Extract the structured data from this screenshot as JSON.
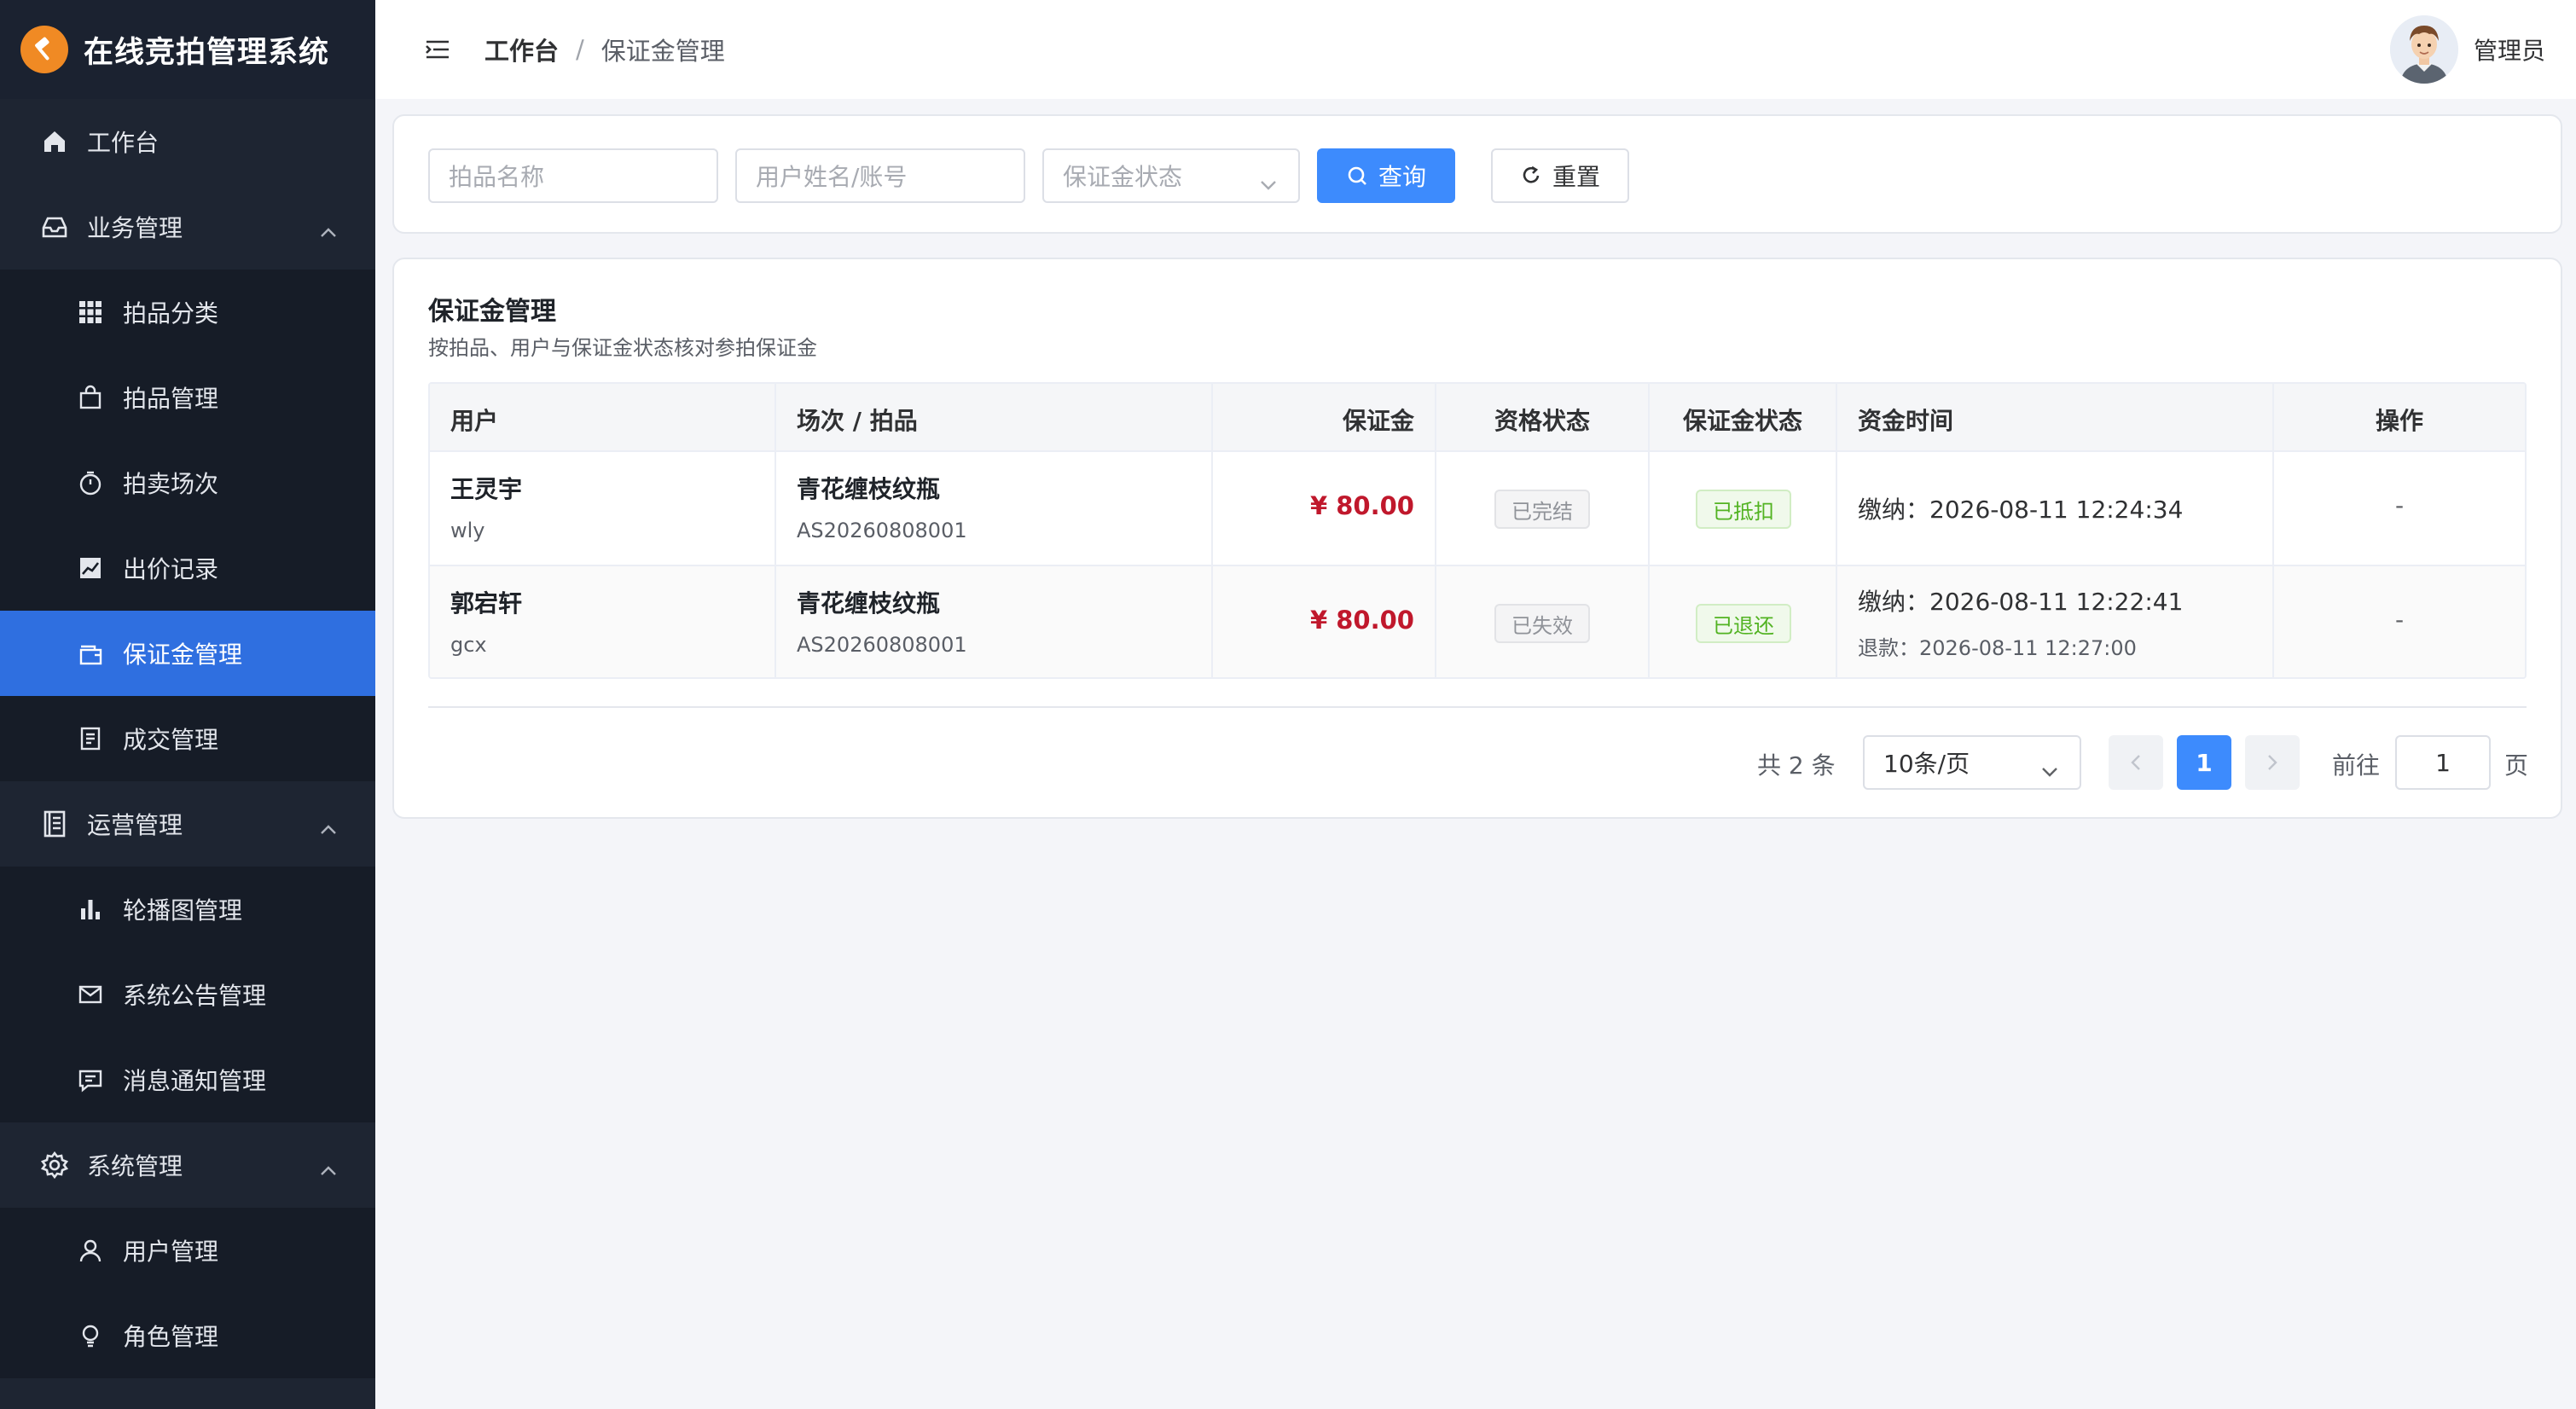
{
  "app": {
    "title": "在线竞拍管理系统"
  },
  "sidebar": {
    "items": [
      {
        "label": "工作台",
        "icon": "home-icon"
      },
      {
        "label": "业务管理",
        "icon": "inbox-icon",
        "expanded": true,
        "children": [
          {
            "label": "拍品分类",
            "icon": "grid-icon"
          },
          {
            "label": "拍品管理",
            "icon": "shopping-bag-icon"
          },
          {
            "label": "拍卖场次",
            "icon": "timer-icon"
          },
          {
            "label": "出价记录",
            "icon": "trend-chart-icon"
          },
          {
            "label": "保证金管理",
            "icon": "wallet-icon",
            "active": true
          },
          {
            "label": "成交管理",
            "icon": "document-icon"
          }
        ]
      },
      {
        "label": "运营管理",
        "icon": "notebook-icon",
        "expanded": true,
        "children": [
          {
            "label": "轮播图管理",
            "icon": "bar-chart-icon"
          },
          {
            "label": "系统公告管理",
            "icon": "message-icon"
          },
          {
            "label": "消息通知管理",
            "icon": "chat-icon"
          }
        ]
      },
      {
        "label": "系统管理",
        "icon": "gear-icon",
        "expanded": true,
        "children": [
          {
            "label": "用户管理",
            "icon": "user-icon"
          },
          {
            "label": "角色管理",
            "icon": "bulb-icon"
          }
        ]
      }
    ]
  },
  "header": {
    "breadcrumb": {
      "home": "工作台",
      "separator": "/",
      "current": "保证金管理"
    },
    "user": {
      "name": "管理员"
    }
  },
  "search": {
    "item_name_placeholder": "拍品名称",
    "user_placeholder": "用户姓名/账号",
    "status_placeholder": "保证金状态",
    "query_label": "查询",
    "reset_label": "重置"
  },
  "table_section": {
    "title": "保证金管理",
    "subtitle": "按拍品、用户与保证金状态核对参拍保证金",
    "columns": [
      "用户",
      "场次 / 拍品",
      "保证金",
      "资格状态",
      "保证金状态",
      "资金时间",
      "操作"
    ],
    "rows": [
      {
        "user_name": "王灵宇",
        "user_account": "wly",
        "item_name": "青花缠枝纹瓶",
        "session_code": "AS20260808001",
        "deposit": "¥ 80.00",
        "qualification_status": "已完结",
        "deposit_status": "已抵扣",
        "paid_time": "缴纳：2026-08-11 12:24:34",
        "refund_time": "",
        "action": "-"
      },
      {
        "user_name": "郭宕轩",
        "user_account": "gcx",
        "item_name": "青花缠枝纹瓶",
        "session_code": "AS20260808001",
        "deposit": "¥ 80.00",
        "qualification_status": "已失效",
        "deposit_status": "已退还",
        "paid_time": "缴纳：2026-08-11 12:22:41",
        "refund_time": "退款：2026-08-11 12:27:00",
        "action": "-"
      }
    ]
  },
  "pagination": {
    "total": "共 2 条",
    "page_size": "10条/页",
    "current_page": "1",
    "goto_label": "前往",
    "goto_value": "1",
    "page_suffix": "页"
  },
  "colors": {
    "sidebar_bg": "#1e2532",
    "active_bg": "#2f6fe0",
    "primary": "#3d8bfd",
    "amount": "#c0182c",
    "brand_logo": "#f08a24"
  }
}
